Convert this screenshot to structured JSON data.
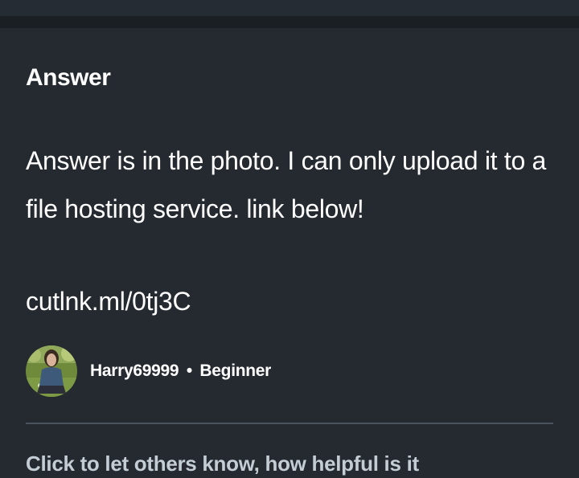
{
  "answer_section": {
    "title": "Answer",
    "body": "Answer is in the photo. I can only upload it to a file hosting service. link below!",
    "link": "cutlnk.ml/0tj3C"
  },
  "author": {
    "name": "Harry69999",
    "separator": "•",
    "rank": "Beginner",
    "avatar_icon": "user-photo-avatar"
  },
  "feedback": {
    "prompt": "Click to let others know, how helpful is it"
  },
  "colors": {
    "background": "#242a30",
    "top_bar": "#1a1f24",
    "text": "#ffffff",
    "muted_text": "#c4ccd4",
    "divider": "#4a535b"
  }
}
